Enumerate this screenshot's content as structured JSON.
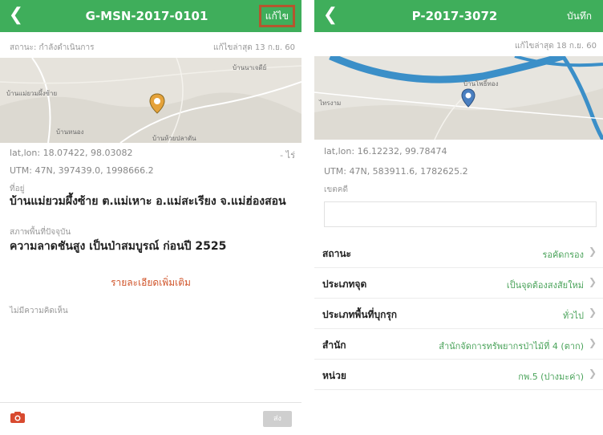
{
  "left": {
    "header": {
      "title": "G-MSN-2017-0101",
      "action_label": "แก้ไข"
    },
    "status_text": "สถานะ: กำลังดำเนินการ",
    "updated_text": "แก้ไขล่าสุด 13 ก.ย. 60",
    "map": {
      "labels": [
        "บ้านแม่ยวมผึ้งซ้าย",
        "บ้านนาเจดีย์",
        "บ้านหนอง",
        "บ้านห้วยปลาดัน"
      ]
    },
    "coordinates": {
      "latlon": "lat,lon: 18.07422, 98.03082",
      "latlon_suffix": "- ไร่",
      "utm": "UTM: 47N, 397439.0, 1998666.2"
    },
    "address": {
      "label": "ที่อยู่",
      "value": "บ้านแม่ยวมผึ้งซ้าย ต.แม่เหาะ อ.แม่สะเรียง จ.แม่ฮ่องสอน"
    },
    "condition": {
      "label": "สภาพพื้นที่ปัจจุบัน",
      "value": "ความลาดชันสูง เป็นป่าสมบูรณ์ ก่อนปี 2525"
    },
    "more_details": "รายละเอียดเพิ่มเติม",
    "no_comments": "ไม่มีความคิดเห็น",
    "bottom": {
      "send_label": "ส่ง"
    }
  },
  "right": {
    "header": {
      "title": "P-2017-3072",
      "action_label": "บันทึก"
    },
    "updated_text": "แก้ไขล่าสุด 18 ก.ย. 60",
    "map": {
      "labels": [
        "บ้านโพธิ์ทอง",
        "ไทรงาม"
      ]
    },
    "coordinates": {
      "latlon": "lat,lon: 16.12232, 99.78474",
      "utm": "UTM: 47N, 583911.6, 1782625.2"
    },
    "remark": {
      "label": "เขตคดี",
      "value": ""
    },
    "rows": [
      {
        "label": "สถานะ",
        "value": "รอคัดกรอง"
      },
      {
        "label": "ประเภทจุด",
        "value": "เป็นจุดต้องสงสัยใหม่"
      },
      {
        "label": "ประเภทพื้นที่บุกรุก",
        "value": "ทั่วไป"
      },
      {
        "label": "สำนัก",
        "value": "สำนักจัดการทรัพยากรป่าไม้ที่ 4 (ตาก)"
      },
      {
        "label": "หน่วย",
        "value": "กพ.5 (ปางมะค่า)"
      }
    ]
  },
  "colors": {
    "header_green": "#3fae5b",
    "highlight_border": "#b4562e",
    "accent_orange": "#d0542a",
    "value_green": "#4aa35a"
  },
  "icons": [
    "chevron-left-icon",
    "map-pin-icon",
    "camera-icon",
    "chevron-right-icon"
  ]
}
